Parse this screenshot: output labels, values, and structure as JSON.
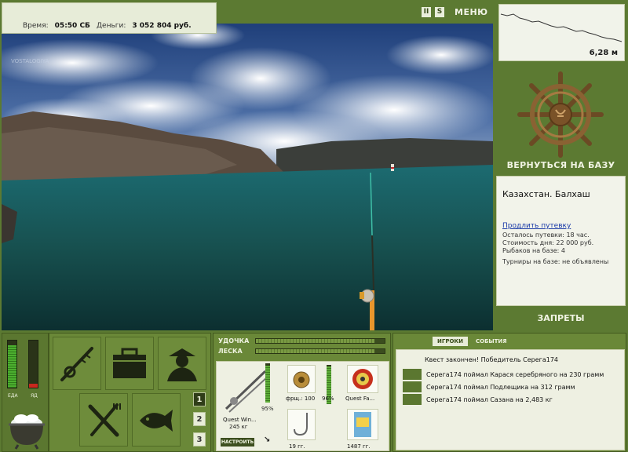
{
  "status": {
    "time_label": "Время:",
    "time_value": "05:50 СБ",
    "money_label": "Деньги:",
    "money_value": "3 052 804 руб."
  },
  "scene": {
    "watermark": "VOSTALOGIYA"
  },
  "top_icons": {
    "pause": "II",
    "sound": "S",
    "menu_label": "МЕНЮ"
  },
  "depth": {
    "value": "6,28 м"
  },
  "base": {
    "return_label": "ВЕРНУТЬСЯ НА БАЗУ"
  },
  "location": {
    "title": "Казахстан. Балхаш",
    "extend_link": "Продлить путевку",
    "remaining": "Осталось путевки: 18 час.",
    "day_cost": "Стоимость дня: 22 000 руб.",
    "anglers": "Рыбаков на базе: 4",
    "tournaments": "Турниры на базе: не объявлены"
  },
  "bans_label": "ЗАПРЕТЫ",
  "meters": {
    "food_label": "ЕДА",
    "poison_label": "ЯД",
    "food_level": 0.9,
    "poison_level": 0.08
  },
  "slots": [
    "1",
    "2",
    "3"
  ],
  "gear": {
    "rod_label": "УДОЧКА",
    "line_label": "ЛЕСКА",
    "rod_tension": 0.92,
    "line_tension": 0.92,
    "rod_name": "Quest Win...",
    "rod_weight": "245 кг",
    "rod_pct": "95%",
    "rod_durability": 0.95,
    "reel_label": "фрщ.: 100",
    "reel_pct": "96%",
    "reel_durability": 0.96,
    "line_name": "Quest Fa...",
    "hook_weight": "19 гг.",
    "bait_weight": "1487 гг.",
    "setup_label": "НАСТРОИТЬ"
  },
  "chat": {
    "tabs": [
      "ИГРОКИ",
      "СОБЫТИЯ"
    ],
    "messages": [
      "Квест закончен! Победитель Серега174",
      "Серега174 поймал Карася серебряного на 230 грамм",
      "Серега174 поймал Подлещика на 312 грамм",
      "Серега174 поймал Сазана на 2,483 кг"
    ]
  },
  "colors": {
    "panel_green": "#6a8838",
    "dark_green": "#3d4f1f",
    "food_green": "#4caf2f",
    "poison_red": "#c8281e"
  }
}
